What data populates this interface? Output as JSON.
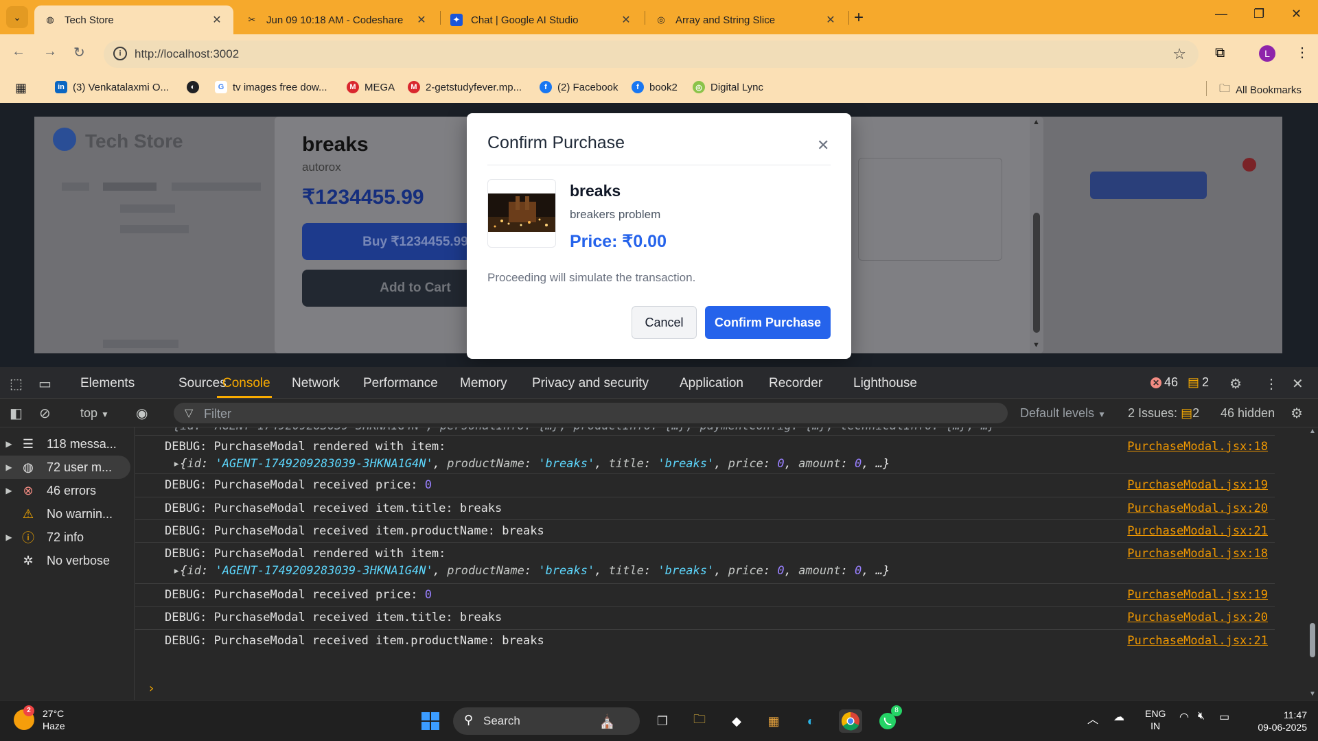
{
  "browser": {
    "tabs": [
      {
        "title": "Tech Store",
        "active": true
      },
      {
        "title": "Jun 09 10:18 AM - Codeshare",
        "active": false
      },
      {
        "title": "Chat | Google AI Studio",
        "active": false
      },
      {
        "title": "Array and String Slice",
        "active": false
      }
    ],
    "url": "http://localhost:3002",
    "profile_initial": "L",
    "bookmarks": [
      {
        "label": "(3) Venkatalaxmi O...",
        "color": "#0a66c2",
        "glyph": "in"
      },
      {
        "label": "",
        "color": "#202124",
        "glyph": "◐"
      },
      {
        "label": "tv images free dow...",
        "color": "#4285f4",
        "glyph": "G"
      },
      {
        "label": "MEGA",
        "color": "#d9272e",
        "glyph": "M"
      },
      {
        "label": "2-getstudyfever.mp...",
        "color": "#d9272e",
        "glyph": "M"
      },
      {
        "label": "(2) Facebook",
        "color": "#1877f2",
        "glyph": "f"
      },
      {
        "label": "book2",
        "color": "#1877f2",
        "glyph": "f"
      },
      {
        "label": "Digital Lync",
        "color": "#8bc34a",
        "glyph": "◎"
      }
    ],
    "all_bookmarks": "All Bookmarks"
  },
  "page": {
    "store_title": "Tech Store",
    "product": {
      "name": "breaks",
      "brand": "autorox",
      "price": "₹1234455.99",
      "buy_label": "Buy ₹1234455.99",
      "cart_label": "Add to Cart"
    },
    "modal": {
      "title": "Confirm Purchase",
      "item_name": "breaks",
      "item_desc": "breakers problem",
      "item_price": "Price: ₹0.00",
      "note": "Proceeding will simulate the transaction.",
      "cancel_label": "Cancel",
      "confirm_label": "Confirm Purchase"
    }
  },
  "devtools": {
    "tabs": [
      "Elements",
      "Sources",
      "Console",
      "Network",
      "Performance",
      "Memory",
      "Privacy and security",
      "Application",
      "Recorder",
      "Lighthouse"
    ],
    "active_tab": "Console",
    "error_count": "46",
    "issue_count": "2",
    "context": "top",
    "filter_placeholder": "Filter",
    "levels": "Default levels",
    "issues_label": "2 Issues:",
    "issues_num": "2",
    "hidden": "46 hidden",
    "sidebar": [
      {
        "label": "118 messa...",
        "icon": "list-icon"
      },
      {
        "label": "72 user m...",
        "icon": "user-icon"
      },
      {
        "label": "46 errors",
        "icon": "error-icon"
      },
      {
        "label": "No warnin...",
        "icon": "warning-icon"
      },
      {
        "label": "72 info",
        "icon": "info-icon"
      },
      {
        "label": "No verbose",
        "icon": "bug-icon"
      }
    ],
    "partial_line": "{id: 'AGENT-1749209283039-3HKNA1G4N', personalInfo: {…}, productInfo: {…}, paymentConfig: {…}, technicalInfo: {…}, …}",
    "logs": [
      {
        "text": "DEBUG: PurchaseModal rendered with item:",
        "src": "PurchaseModal.jsx:18",
        "obj": true
      },
      {
        "text": "DEBUG: PurchaseModal received price: ",
        "num": "0",
        "src": "PurchaseModal.jsx:19"
      },
      {
        "text": "DEBUG: PurchaseModal received item.title: breaks",
        "src": "PurchaseModal.jsx:20"
      },
      {
        "text": "DEBUG: PurchaseModal received item.productName: breaks",
        "src": "PurchaseModal.jsx:21"
      },
      {
        "text": "DEBUG: PurchaseModal rendered with item:",
        "src": "PurchaseModal.jsx:18",
        "obj": true
      },
      {
        "text": "DEBUG: PurchaseModal received price: ",
        "num": "0",
        "src": "PurchaseModal.jsx:19"
      },
      {
        "text": "DEBUG: PurchaseModal received item.title: breaks",
        "src": "PurchaseModal.jsx:20"
      },
      {
        "text": "DEBUG: PurchaseModal received item.productName: breaks",
        "src": "PurchaseModal.jsx:21"
      }
    ],
    "object_preview": {
      "id": "'AGENT-1749209283039-3HKNA1G4N'",
      "productName": "'breaks'",
      "title": "'breaks'",
      "price": "0",
      "amount": "0"
    }
  },
  "taskbar": {
    "temp": "27°C",
    "weather": "Haze",
    "weather_badge": "2",
    "search": "Search",
    "lang": "ENG",
    "region": "IN",
    "time": "11:47",
    "date": "09-06-2025",
    "whatsapp_badge": "8"
  },
  "colors": {
    "accent": "#2563eb",
    "tabstrip": "#f6a92c",
    "devtools_active": "#f9ab00"
  }
}
